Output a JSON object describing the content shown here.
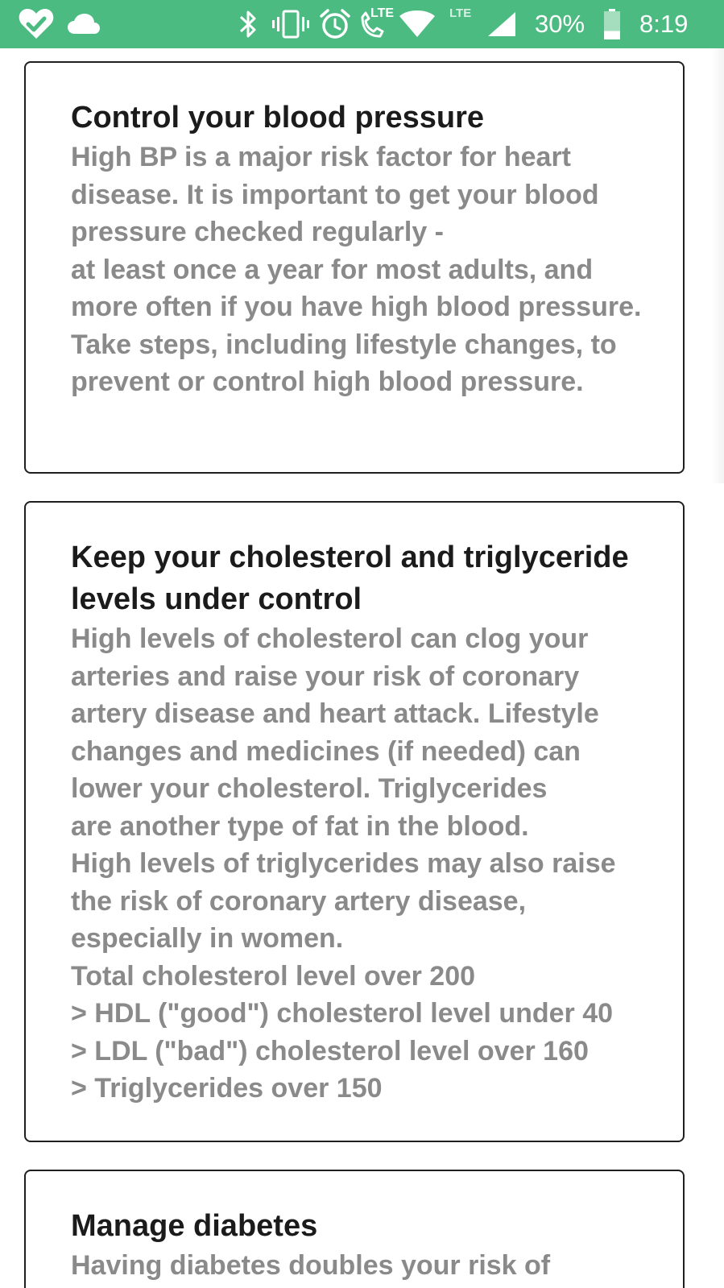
{
  "status_bar": {
    "background": "#4cbb82",
    "left_icons": [
      "heart-check-icon",
      "cloud-icon"
    ],
    "right_icons": [
      "bluetooth-icon",
      "vibrate-icon",
      "alarm-icon",
      "lte-call-icon",
      "wifi-icon",
      "lte-signal-icon",
      "battery-icon"
    ],
    "lte_call_label": "LTE",
    "lte_signal_label": "LTE",
    "battery_percent": "30%",
    "battery_level": 0.3,
    "time": "8:19"
  },
  "cards": [
    {
      "title": "Control your blood pressure",
      "body": "High BP is a major risk factor for heart disease. It is important to get your blood pressure checked regularly -\nat least once a year for most adults, and more often if you have high blood pressure. Take steps, including lifestyle changes, to prevent or control high blood pressure."
    },
    {
      "title": "Keep your cholesterol and triglyceride levels under control",
      "body": "High levels of cholesterol can clog your arteries and raise your risk of coronary artery disease and heart attack. Lifestyle changes and medicines (if needed) can lower your cholesterol. Triglycerides\nare another type of fat in the blood.\nHigh levels of triglycerides may also raise the risk of coronary artery disease, especially in women.\nTotal cholesterol level over 200\n> HDL (\"good\") cholesterol level under 40\n> LDL (\"bad\") cholesterol level over 160\n> Triglycerides over 150"
    },
    {
      "title": "Manage diabetes",
      "body": "Having diabetes doubles your risk of"
    }
  ]
}
